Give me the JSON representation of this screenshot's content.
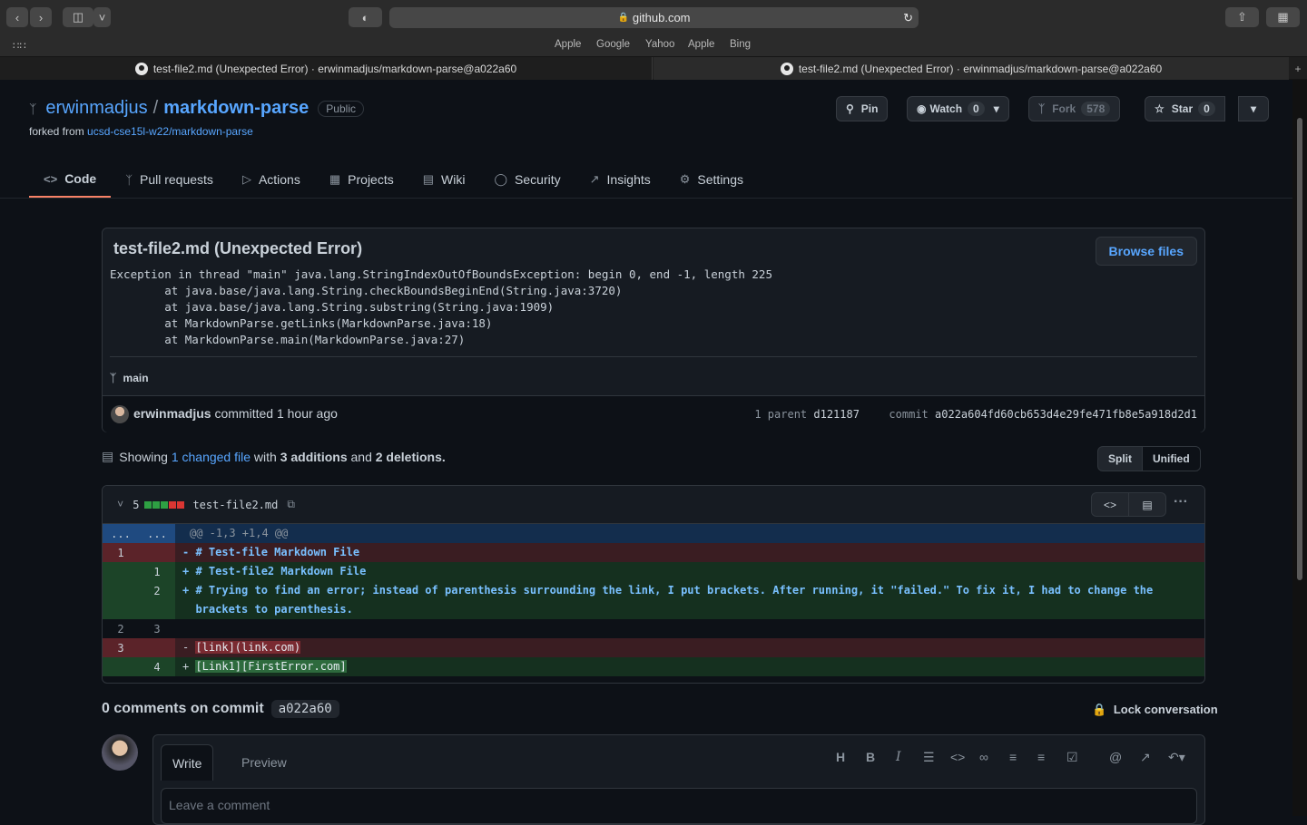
{
  "browser": {
    "url": "github.com",
    "bookmarks": [
      "Apple",
      "Google",
      "Yahoo",
      "Apple",
      "Bing"
    ],
    "tabs": [
      {
        "title": "test-file2.md (Unexpected Error) · erwinmadjus/markdown-parse@a022a60"
      },
      {
        "title": "test-file2.md (Unexpected Error) · erwinmadjus/markdown-parse@a022a60"
      }
    ]
  },
  "repo": {
    "owner": "erwinmadjus",
    "separator": "/",
    "name": "markdown-parse",
    "visibility": "Public",
    "forked_prefix": "forked from",
    "forked_from": "ucsd-cse15l-w22/markdown-parse",
    "pin": "Pin",
    "watch": "Watch",
    "watch_count": "0",
    "fork": "Fork",
    "fork_count": "578",
    "star": "Star",
    "star_count": "0"
  },
  "nav": [
    {
      "label": "Code",
      "icon": "code-icon"
    },
    {
      "label": "Pull requests",
      "icon": "pull-request-icon"
    },
    {
      "label": "Actions",
      "icon": "play-icon"
    },
    {
      "label": "Projects",
      "icon": "table-icon"
    },
    {
      "label": "Wiki",
      "icon": "book-icon"
    },
    {
      "label": "Security",
      "icon": "shield-icon"
    },
    {
      "label": "Insights",
      "icon": "graph-icon"
    },
    {
      "label": "Settings",
      "icon": "gear-icon"
    }
  ],
  "commit": {
    "title": "test-file2.md (Unexpected Error)",
    "message": "Exception in thread \"main\" java.lang.StringIndexOutOfBoundsException: begin 0, end -1, length 225\n        at java.base/java.lang.String.checkBoundsBeginEnd(String.java:3720)\n        at java.base/java.lang.String.substring(String.java:1909)\n        at MarkdownParse.getLinks(MarkdownParse.java:18)\n        at MarkdownParse.main(MarkdownParse.java:27)",
    "browse_files": "Browse files",
    "branch": "main",
    "author": "erwinmadjus",
    "committed_text": "committed 1 hour ago",
    "parent_label": "1 parent",
    "parent_sha": "d121187",
    "commit_label": "commit",
    "commit_sha": "a022a604fd60cb653d4e29fe471fb8e5a918d2d1"
  },
  "diff_stats": {
    "showing": "Showing",
    "changed_files": "1 changed file",
    "with": "with",
    "additions": "3 additions",
    "and": "and",
    "deletions": "2 deletions.",
    "split": "Split",
    "unified": "Unified"
  },
  "diff": {
    "changes": "5",
    "filename": "test-file2.md",
    "hunk_dots_old": "...",
    "hunk_dots_new": "...",
    "hunk": "@@ -1,3 +1,4 @@",
    "lines": [
      {
        "old": "1",
        "new": "",
        "text": "- # Test-file Markdown File"
      },
      {
        "old": "",
        "new": "1",
        "text": "+ # Test-file2 Markdown File"
      },
      {
        "old": "",
        "new": "2",
        "text": "+ # Trying to find an error; instead of parenthesis surrounding the link, I put brackets. After running, it \"failed.\" To fix it, I had to change the\n  brackets to parenthesis."
      },
      {
        "old": "2",
        "new": "3",
        "text": ""
      },
      {
        "old": "3",
        "new": "",
        "prefix": "- ",
        "hl": "[link](link.com)"
      },
      {
        "old": "",
        "new": "4",
        "prefix": "+ ",
        "hl": "[Link1][FirstError.com]"
      }
    ]
  },
  "comments": {
    "heading": "0 comments on commit",
    "sha": "a022a60",
    "lock": "Lock conversation",
    "write_tab": "Write",
    "preview_tab": "Preview",
    "placeholder": "Leave a comment",
    "toolbar": [
      "H",
      "B",
      "I"
    ]
  }
}
